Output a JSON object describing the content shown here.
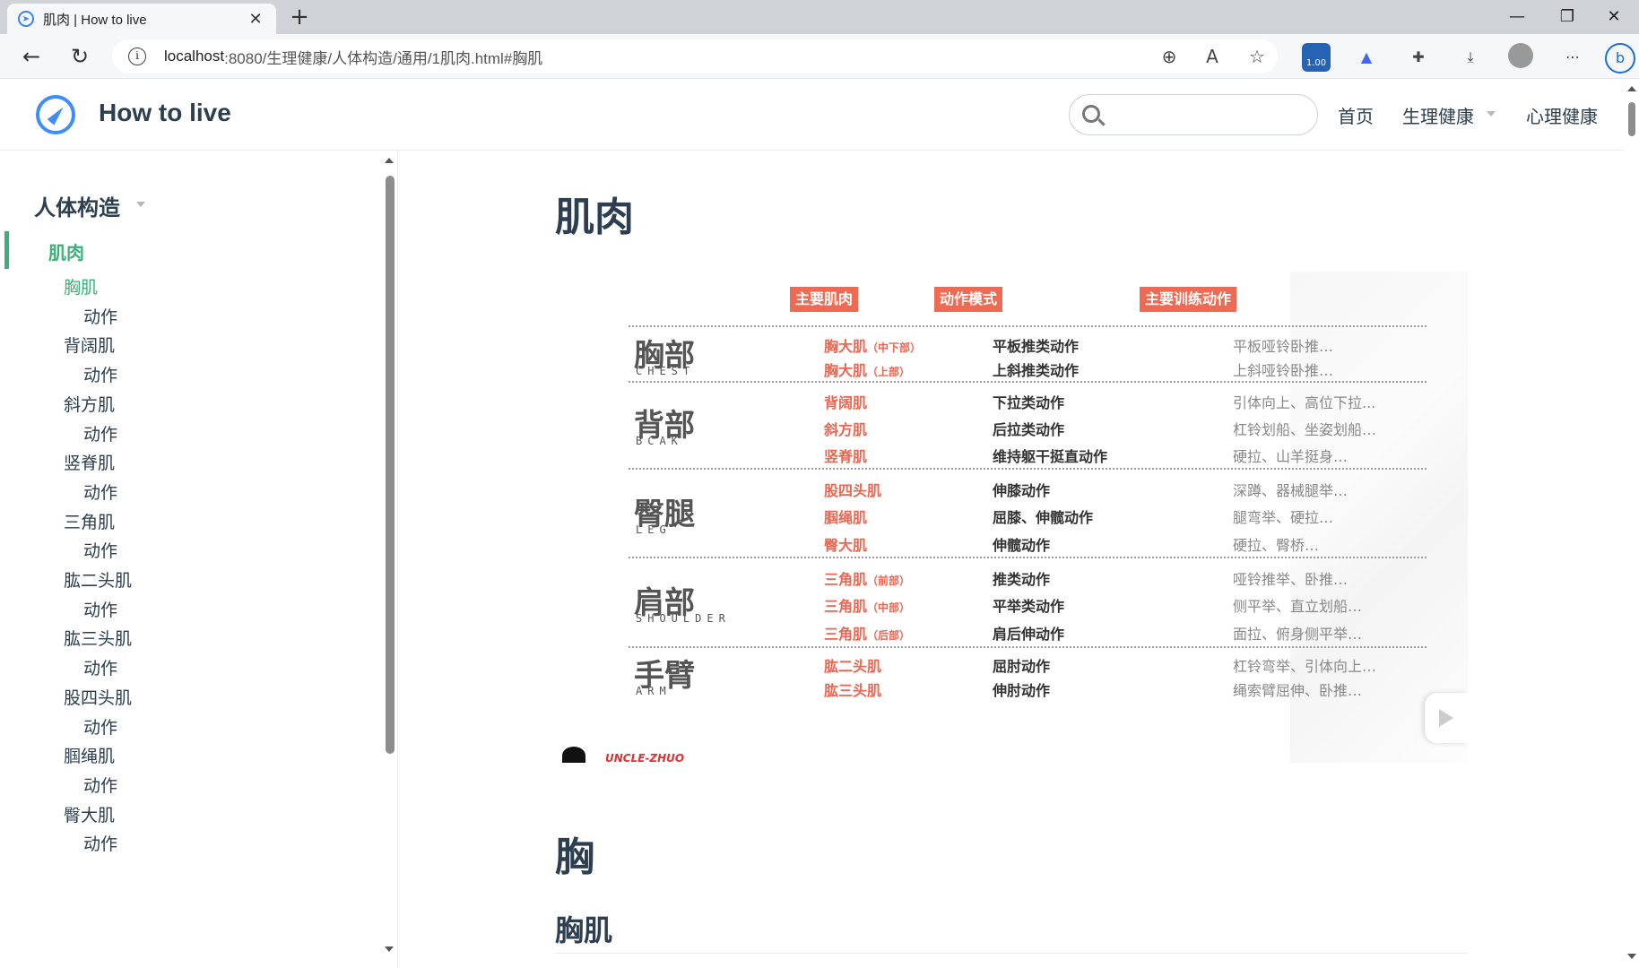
{
  "browser": {
    "tab_title": "肌肉 | How to live",
    "url_host": "localhost",
    "url_path": ":8080/生理健康/人体构造/通用/1肌肉.html#胸肌",
    "ext_badge": "1.00"
  },
  "header": {
    "site_name": "How to live",
    "search_placeholder": "",
    "nav": [
      {
        "label": "首页"
      },
      {
        "label": "生理健康"
      },
      {
        "label": "心理健康"
      }
    ]
  },
  "sidebar": {
    "group": "人体构造",
    "section": "肌肉",
    "items": [
      {
        "label": "胸肌",
        "level": 2,
        "active": true
      },
      {
        "label": "动作",
        "level": 3
      },
      {
        "label": "背阔肌",
        "level": 2
      },
      {
        "label": "动作",
        "level": 3
      },
      {
        "label": "斜方肌",
        "level": 2
      },
      {
        "label": "动作",
        "level": 3
      },
      {
        "label": "竖脊肌",
        "level": 2
      },
      {
        "label": "动作",
        "level": 3
      },
      {
        "label": "三角肌",
        "level": 2
      },
      {
        "label": "动作",
        "level": 3
      },
      {
        "label": "肱二头肌",
        "level": 2
      },
      {
        "label": "动作",
        "level": 3
      },
      {
        "label": "肱三头肌",
        "level": 2
      },
      {
        "label": "动作",
        "level": 3
      },
      {
        "label": "股四头肌",
        "level": 2
      },
      {
        "label": "动作",
        "level": 3
      },
      {
        "label": "腘绳肌",
        "level": 2
      },
      {
        "label": "动作",
        "level": 3
      },
      {
        "label": "臀大肌",
        "level": 2
      },
      {
        "label": "动作",
        "level": 3
      }
    ]
  },
  "main": {
    "h1": "肌肉",
    "h2": "胸",
    "h3": "胸肌"
  },
  "figure": {
    "headers": [
      "主要肌肉",
      "动作模式",
      "主要训练动作"
    ],
    "groups": [
      {
        "cn": "胸部",
        "en": "CHEST",
        "rows": [
          {
            "muscle": "胸大肌",
            "sub": "（中下部）",
            "pattern": "平板推类动作",
            "exercise": "平板哑铃卧推…"
          },
          {
            "muscle": "胸大肌",
            "sub": "（上部）",
            "pattern": "上斜推类动作",
            "exercise": "上斜哑铃卧推…"
          }
        ]
      },
      {
        "cn": "背部",
        "en": "BCAK",
        "rows": [
          {
            "muscle": "背阔肌",
            "sub": "",
            "pattern": "下拉类动作",
            "exercise": "引体向上、高位下拉..."
          },
          {
            "muscle": "斜方肌",
            "sub": "",
            "pattern": "后拉类动作",
            "exercise": "杠铃划船、坐姿划船…"
          },
          {
            "muscle": "竖脊肌",
            "sub": "",
            "pattern": "维持躯干挺直动作",
            "exercise": "硬拉、山羊挺身…"
          }
        ]
      },
      {
        "cn": "臀腿",
        "en": "LEG",
        "rows": [
          {
            "muscle": "股四头肌",
            "sub": "",
            "pattern": "伸膝动作",
            "exercise": "深蹲、器械腿举…"
          },
          {
            "muscle": "腘绳肌",
            "sub": "",
            "pattern": "屈膝、伸髋动作",
            "exercise": "腿弯举、硬拉…"
          },
          {
            "muscle": "臀大肌",
            "sub": "",
            "pattern": "伸髋动作",
            "exercise": "硬拉、臀桥…"
          }
        ]
      },
      {
        "cn": "肩部",
        "en": "SHOULDER",
        "rows": [
          {
            "muscle": "三角肌",
            "sub": "（前部）",
            "pattern": "推类动作",
            "exercise": "哑铃推举、卧推…"
          },
          {
            "muscle": "三角肌",
            "sub": "（中部）",
            "pattern": "平举类动作",
            "exercise": "侧平举、直立划船…"
          },
          {
            "muscle": "三角肌",
            "sub": "（后部）",
            "pattern": "肩后伸动作",
            "exercise": "面拉、俯身侧平举…"
          }
        ]
      },
      {
        "cn": "手臂",
        "en": "ARM",
        "rows": [
          {
            "muscle": "肱二头肌",
            "sub": "",
            "pattern": "屈肘动作",
            "exercise": "杠铃弯举、引体向上…"
          },
          {
            "muscle": "肱三头肌",
            "sub": "",
            "pattern": "伸肘动作",
            "exercise": "绳索臂屈伸、卧推…"
          }
        ]
      }
    ],
    "logo_text": "UNCLE-ZHUO"
  },
  "colors": {
    "accent": "#3eaf7c",
    "table_red": "#ec6550",
    "logo_blue": "#3e8ef7"
  },
  "icons": {
    "tab_favicon": "compass-icon",
    "site_logo": "compass-icon"
  }
}
